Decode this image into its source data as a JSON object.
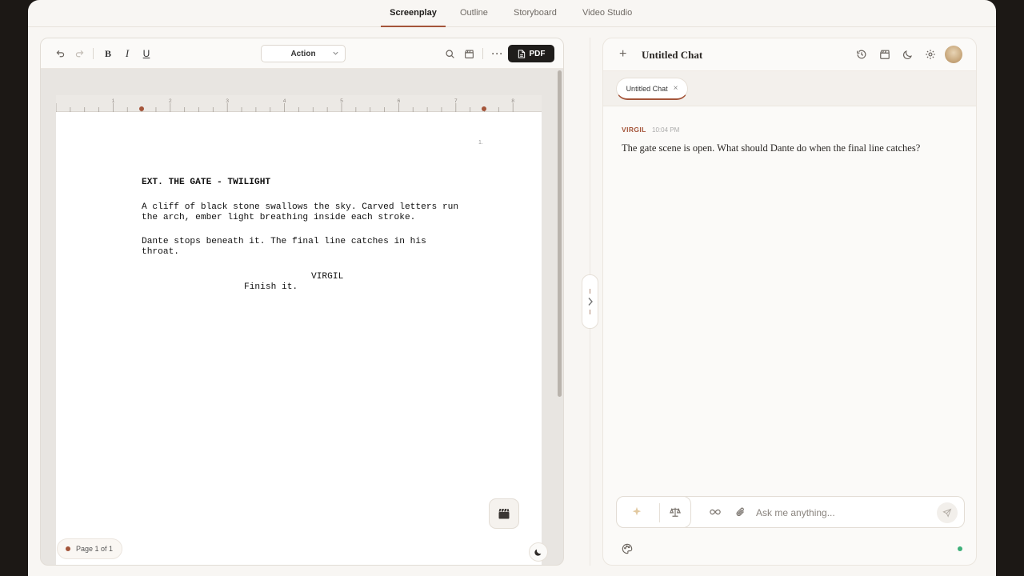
{
  "nav": {
    "tabs": [
      {
        "label": "Screenplay",
        "active": true
      },
      {
        "label": "Outline",
        "active": false
      },
      {
        "label": "Storyboard",
        "active": false
      },
      {
        "label": "Video Studio",
        "active": false
      }
    ]
  },
  "editor": {
    "toolbar": {
      "block_style": "Action",
      "export_label": "PDF"
    },
    "ruler": {
      "numbers": [
        "1",
        "2",
        "3",
        "4",
        "5",
        "6",
        "7",
        "8"
      ]
    },
    "page": {
      "number": "1.",
      "scene_heading": "EXT. THE GATE - TWILIGHT",
      "action_1_line_1": "A cliff of black stone swallows the sky. Carved letters run",
      "action_1_line_2": "the arch, ember light breathing inside each stroke.",
      "action_2_line_1": "Dante stops beneath it. The final line catches in his",
      "action_2_line_2": "throat.",
      "character": "VIRGIL",
      "dialogue": "Finish it."
    },
    "page_indicator": "Page 1 of 1"
  },
  "chat": {
    "title": "Untitled Chat",
    "tab_label": "Untitled Chat",
    "messages": [
      {
        "author": "VIRGIL",
        "time": "10:04 PM",
        "text": "The gate scene is open. What should Dante do when the final line catches?"
      }
    ],
    "composer": {
      "placeholder": "Ask me anything..."
    }
  },
  "colors": {
    "accent": "#a4553a",
    "status_online": "#3eb07a",
    "pdf_button": "#1f1d1b"
  }
}
